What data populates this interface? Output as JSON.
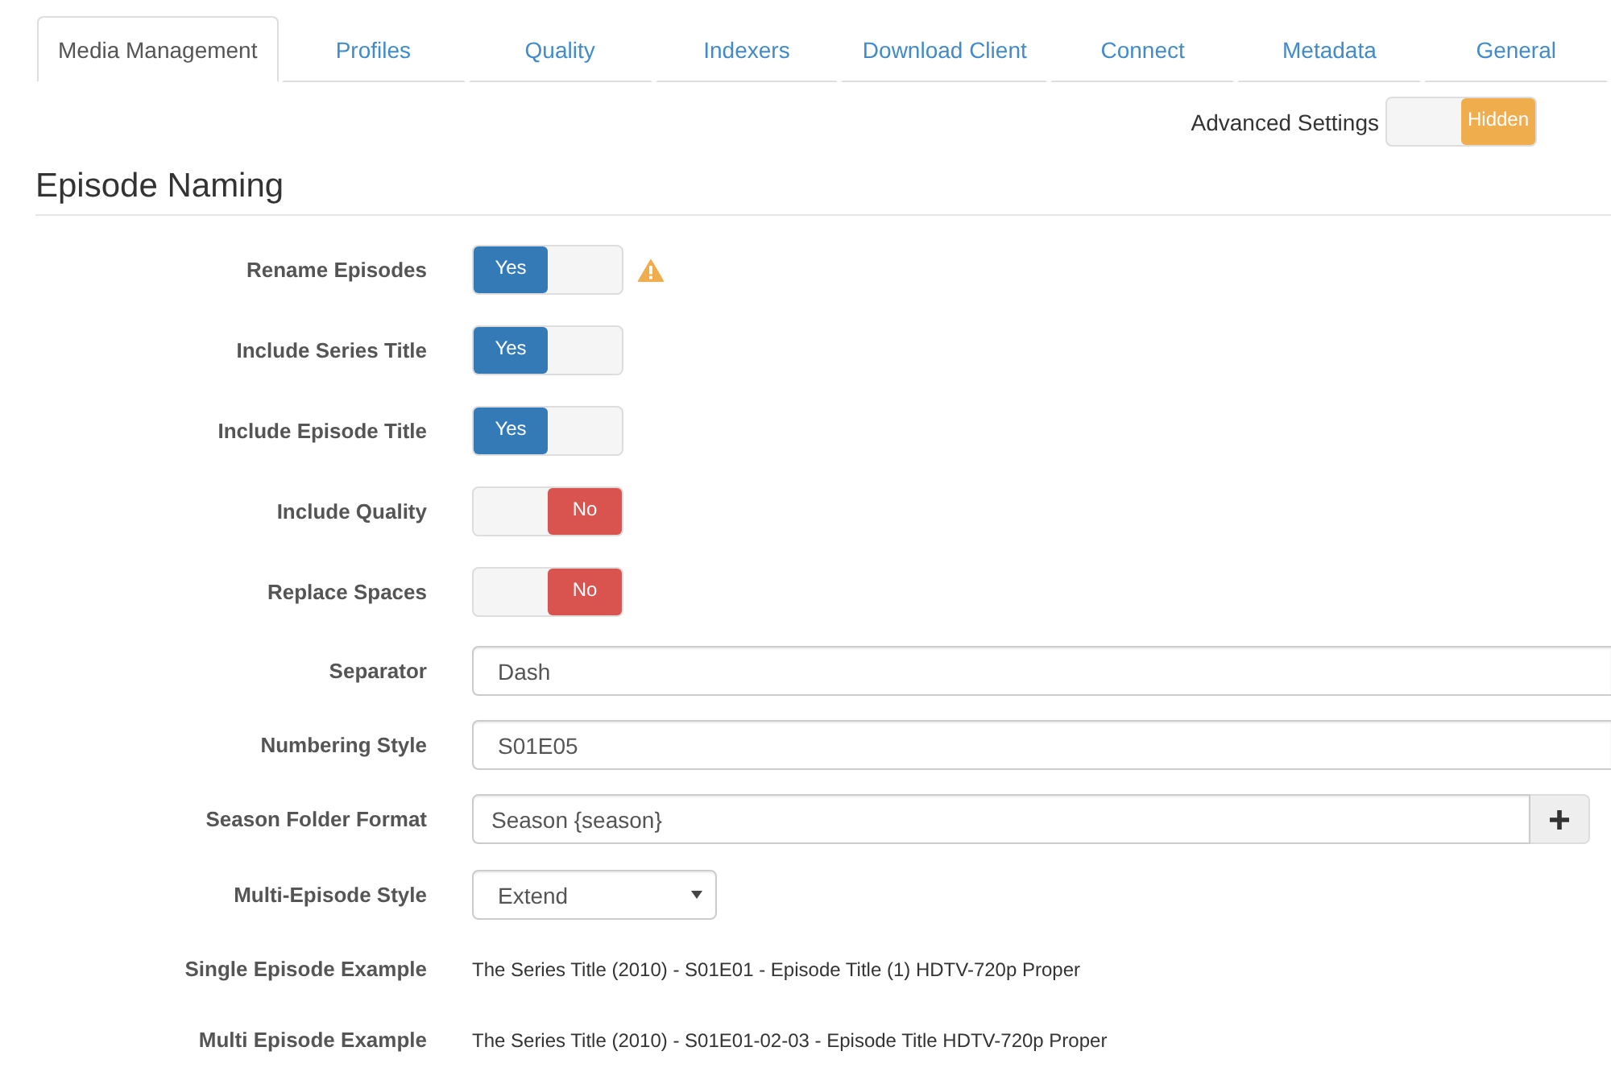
{
  "tabs": [
    {
      "label": "Media Management",
      "selected": true
    },
    {
      "label": "Profiles",
      "selected": false
    },
    {
      "label": "Quality",
      "selected": false
    },
    {
      "label": "Indexers",
      "selected": false
    },
    {
      "label": "Download Client",
      "selected": false
    },
    {
      "label": "Connect",
      "selected": false
    },
    {
      "label": "Metadata",
      "selected": false
    },
    {
      "label": "General",
      "selected": false
    }
  ],
  "advanced_settings": {
    "label": "Advanced Settings",
    "toggle": {
      "state_text": "Hidden",
      "on": false
    }
  },
  "section": {
    "title": "Episode Naming",
    "rows": [
      {
        "kind": "toggle",
        "label": "Rename Episodes",
        "on": true,
        "state_text": "Yes",
        "warning": true
      },
      {
        "kind": "toggle",
        "label": "Include Series Title",
        "on": true,
        "state_text": "Yes",
        "warning": false
      },
      {
        "kind": "toggle",
        "label": "Include Episode Title",
        "on": true,
        "state_text": "Yes",
        "warning": false
      },
      {
        "kind": "toggle",
        "label": "Include Quality",
        "on": false,
        "state_text": "No",
        "warning": false
      },
      {
        "kind": "toggle",
        "label": "Replace Spaces",
        "on": false,
        "state_text": "No",
        "warning": false
      },
      {
        "kind": "input",
        "label": "Separator",
        "value": "Dash"
      },
      {
        "kind": "input",
        "label": "Numbering Style",
        "value": "S01E05"
      },
      {
        "kind": "input_group",
        "label": "Season Folder Format",
        "value": "Season {season}"
      },
      {
        "kind": "select",
        "label": "Multi-Episode Style",
        "value": "Extend"
      },
      {
        "kind": "example",
        "label": "Single Episode Example",
        "value": "The Series Title (2010) - S01E01 - Episode Title (1) HDTV-720p Proper"
      },
      {
        "kind": "example",
        "label": "Multi Episode Example",
        "value": "The Series Title (2010) - S01E01-02-03 - Episode Title HDTV-720p Proper"
      }
    ]
  }
}
